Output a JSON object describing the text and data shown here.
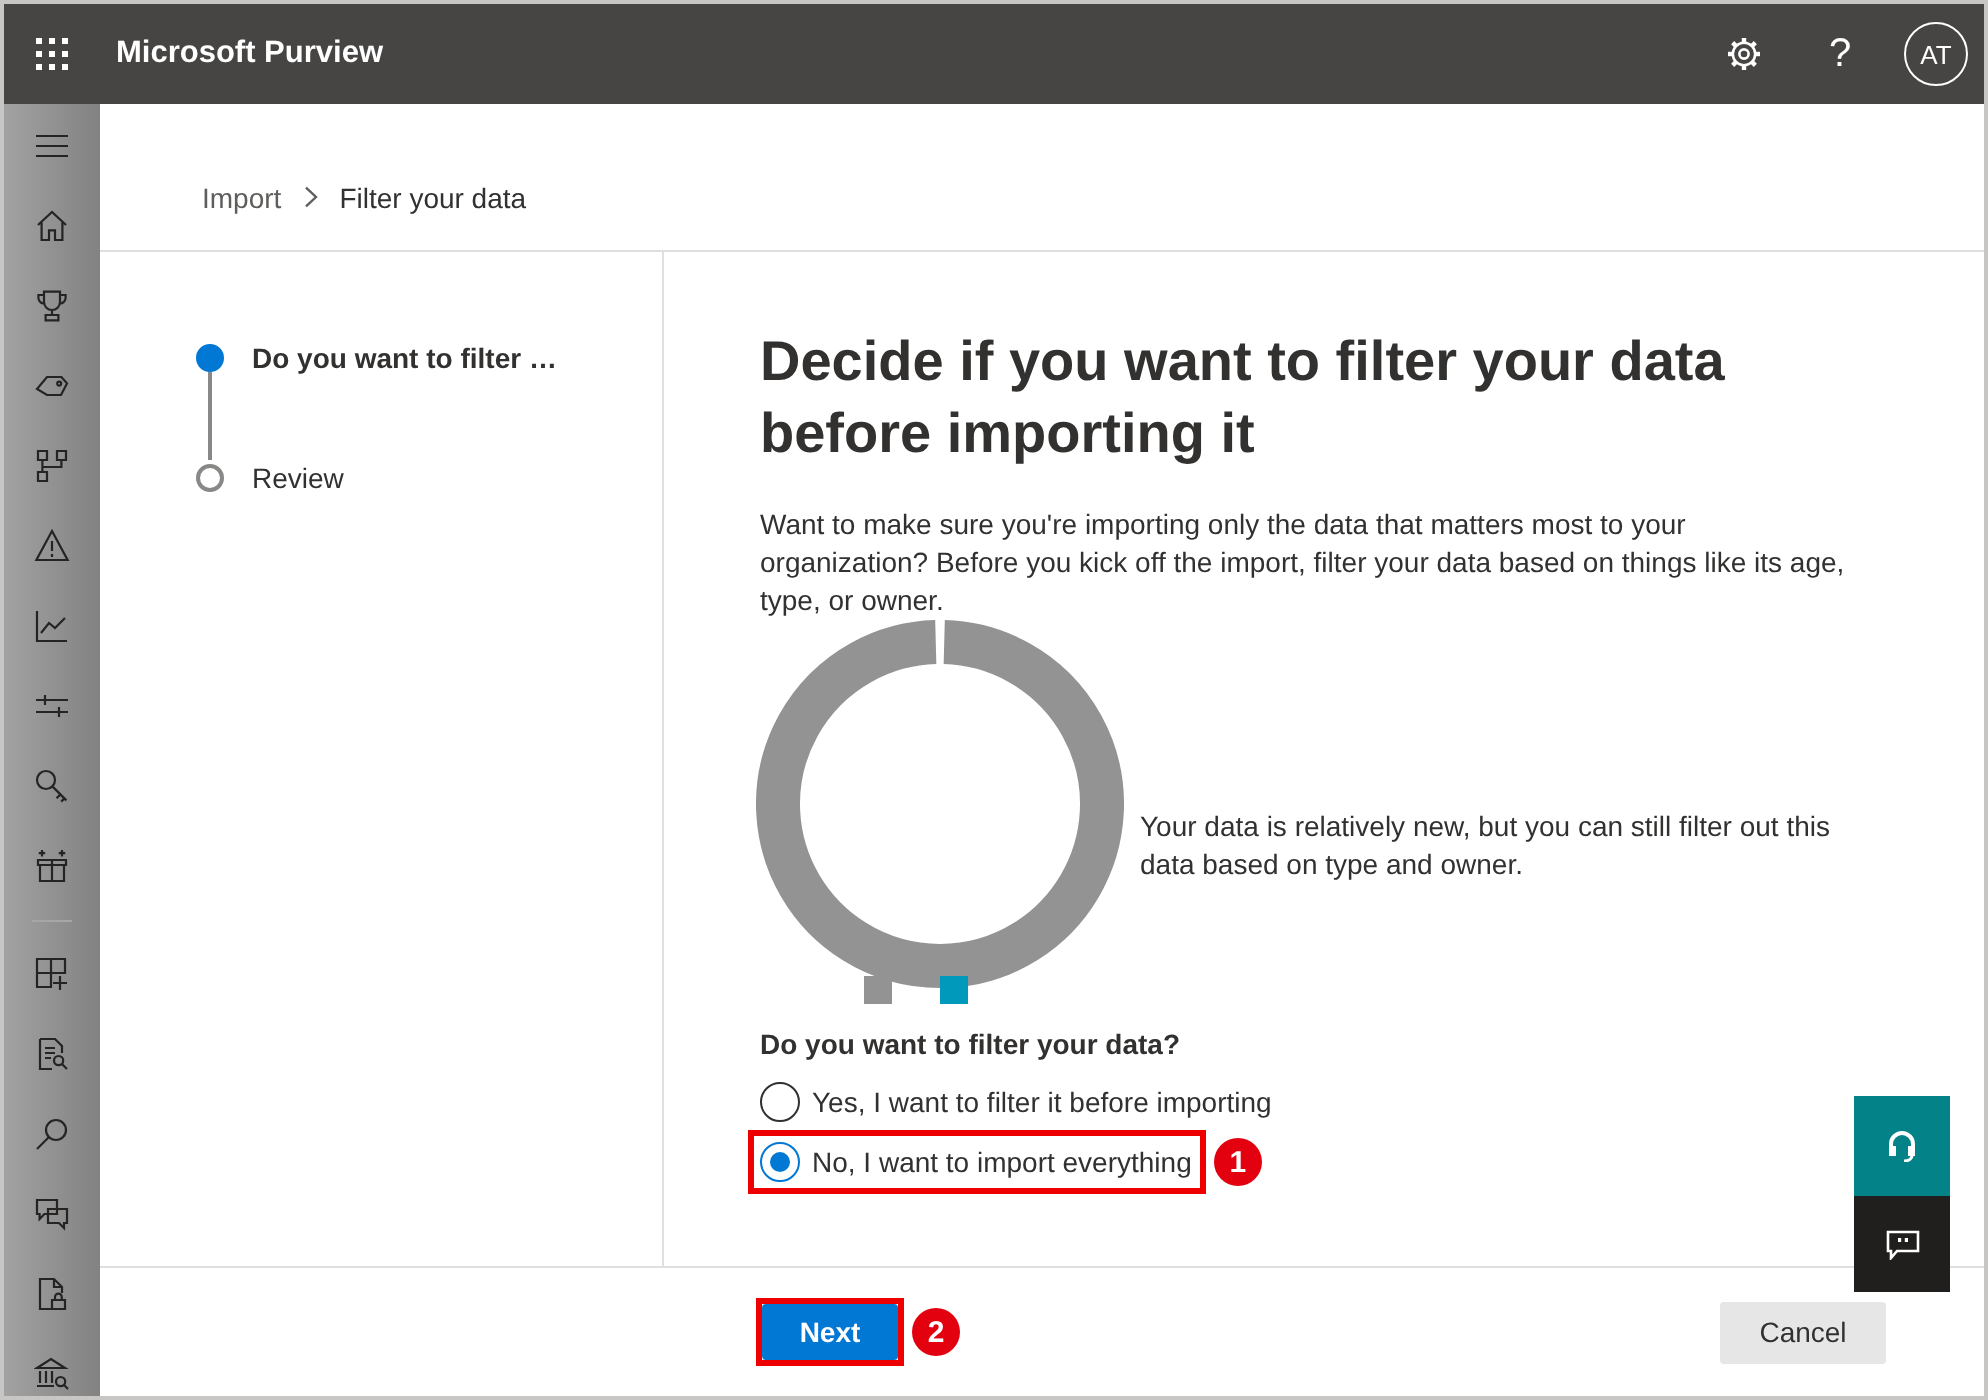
{
  "header": {
    "app_title": "Microsoft Purview",
    "help_label": "?",
    "avatar_initials": "AT"
  },
  "breadcrumb": [
    {
      "label": "Import"
    },
    {
      "label": "Filter your data"
    }
  ],
  "steps": [
    {
      "label": "Do you want to filter …",
      "selected": true
    },
    {
      "label": "Review",
      "selected": false
    }
  ],
  "content": {
    "heading": "Decide if you want to filter your data before importing it",
    "intro": "Want to make sure you're importing only the data that matters most to your organization? Before you kick off the import, filter your data based on things like its age, type, or owner.",
    "chart": {
      "legend": [
        {
          "color": "#939393"
        },
        {
          "color": "#0099bc"
        }
      ]
    },
    "chart_caption": "Your data is relatively new, but you can still filter out this data based on type and owner.",
    "question": "Do you want to filter your data?",
    "options": [
      {
        "label": "Yes, I want to filter it before importing",
        "selected": false,
        "highlighted": false
      },
      {
        "label": "No, I want to import everything",
        "selected": true,
        "highlighted": true,
        "callout": "1"
      }
    ]
  },
  "footer": {
    "buttons": [
      {
        "label": "Next",
        "kind": "primary",
        "highlighted": true,
        "callout": "2"
      },
      {
        "label": "Cancel",
        "kind": "secondary",
        "highlighted": false
      }
    ]
  }
}
